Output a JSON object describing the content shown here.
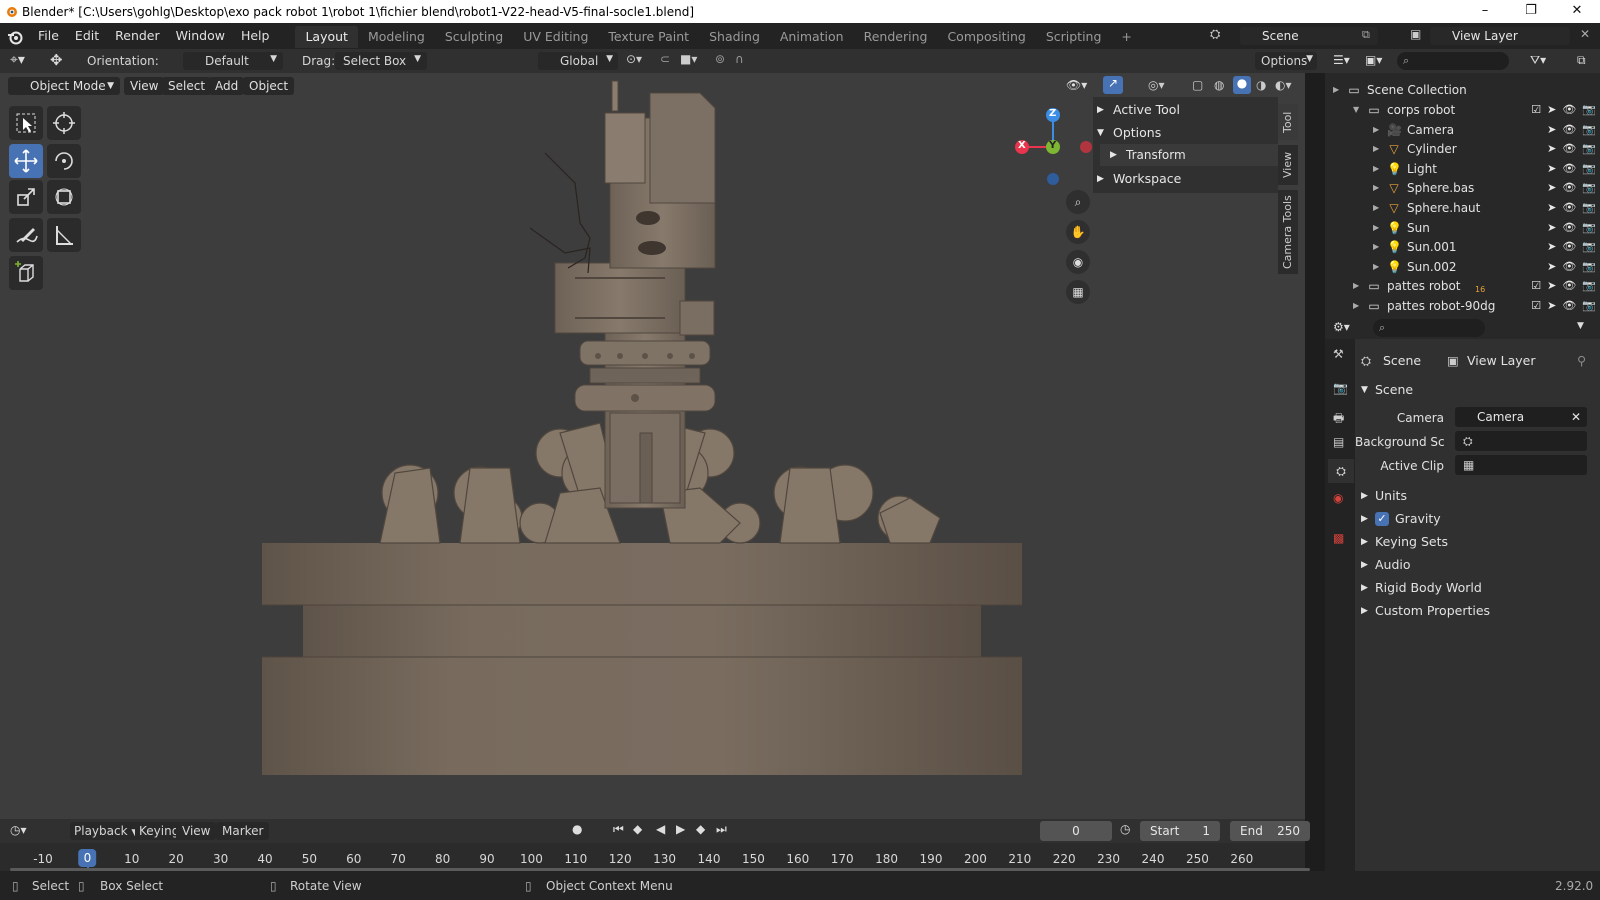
{
  "title_bar": {
    "title": "Blender* [C:\\Users\\gohlg\\Desktop\\exo pack robot 1\\robot 1\\fichier blend\\robot1-V22-head-V5-final-socle1.blend]",
    "minimize": "–",
    "maximize": "❐",
    "close": "✕"
  },
  "menu": [
    "File",
    "Edit",
    "Render",
    "Window",
    "Help"
  ],
  "workspaces": [
    "Layout",
    "Modeling",
    "Sculpting",
    "UV Editing",
    "Texture Paint",
    "Shading",
    "Animation",
    "Rendering",
    "Compositing",
    "Scripting"
  ],
  "add_workspace": "+",
  "scene_selector": "Scene",
  "view_layer_selector": "View Layer",
  "tool_header": {
    "orientation_label": "Orientation:",
    "orientation_value": "Default",
    "drag_label": "Drag:",
    "drag_value": "Select Box",
    "transform_orientation": "Global",
    "options": "Options"
  },
  "viewport_header": {
    "mode": "Object Mode",
    "menus": [
      "View",
      "Select",
      "Add",
      "Object"
    ]
  },
  "gizmo": {
    "x": "X",
    "y": "Y",
    "z": "Z"
  },
  "n_panel": {
    "active_tool": "Active Tool",
    "options": "Options",
    "transform": "Transform",
    "workspace": "Workspace",
    "tabs": [
      "Tool",
      "View",
      "Camera Tools"
    ]
  },
  "outliner": {
    "root": "Scene Collection",
    "rows": [
      {
        "name": "corps robot",
        "type": "collection"
      },
      {
        "name": "Camera",
        "type": "camera"
      },
      {
        "name": "Cylinder",
        "type": "mesh"
      },
      {
        "name": "Light",
        "type": "light"
      },
      {
        "name": "Sphere.bas",
        "type": "mesh"
      },
      {
        "name": "Sphere.haut",
        "type": "mesh"
      },
      {
        "name": "Sun",
        "type": "light"
      },
      {
        "name": "Sun.001",
        "type": "light"
      },
      {
        "name": "Sun.002",
        "type": "light"
      },
      {
        "name": "pattes robot",
        "type": "collection",
        "badge": "16"
      },
      {
        "name": "pattes robot-90dg",
        "type": "collection"
      }
    ]
  },
  "properties": {
    "breadcrumb_scene": "Scene",
    "breadcrumb_view_layer": "View Layer",
    "section": "Scene",
    "camera_label": "Camera",
    "camera_value": "Camera",
    "background_label": "Background Sc...",
    "active_clip_label": "Active Clip",
    "panels": [
      "Units",
      "Gravity",
      "Keying Sets",
      "Audio",
      "Rigid Body World",
      "Custom Properties"
    ]
  },
  "timeline": {
    "menus": [
      "Playback",
      "Keying",
      "View",
      "Marker"
    ],
    "current_frame": "0",
    "start_label": "Start",
    "start_value": "1",
    "end_label": "End",
    "end_value": "250",
    "ticks": [
      "-10",
      "0",
      "10",
      "20",
      "30",
      "40",
      "50",
      "60",
      "70",
      "80",
      "90",
      "100",
      "110",
      "120",
      "130",
      "140",
      "150",
      "160",
      "170",
      "180",
      "190",
      "200",
      "210",
      "220",
      "230",
      "240",
      "250",
      "260"
    ]
  },
  "status_bar": {
    "select": "Select",
    "box_select": "Box Select",
    "rotate_view": "Rotate View",
    "context_menu": "Object Context Menu",
    "version": "2.92.0"
  },
  "colors": {
    "accent": "#4772b3",
    "x_axis": "#e8344c",
    "y_axis": "#7cb632",
    "z_axis": "#3c8ee4",
    "model": "#7a6e62"
  }
}
